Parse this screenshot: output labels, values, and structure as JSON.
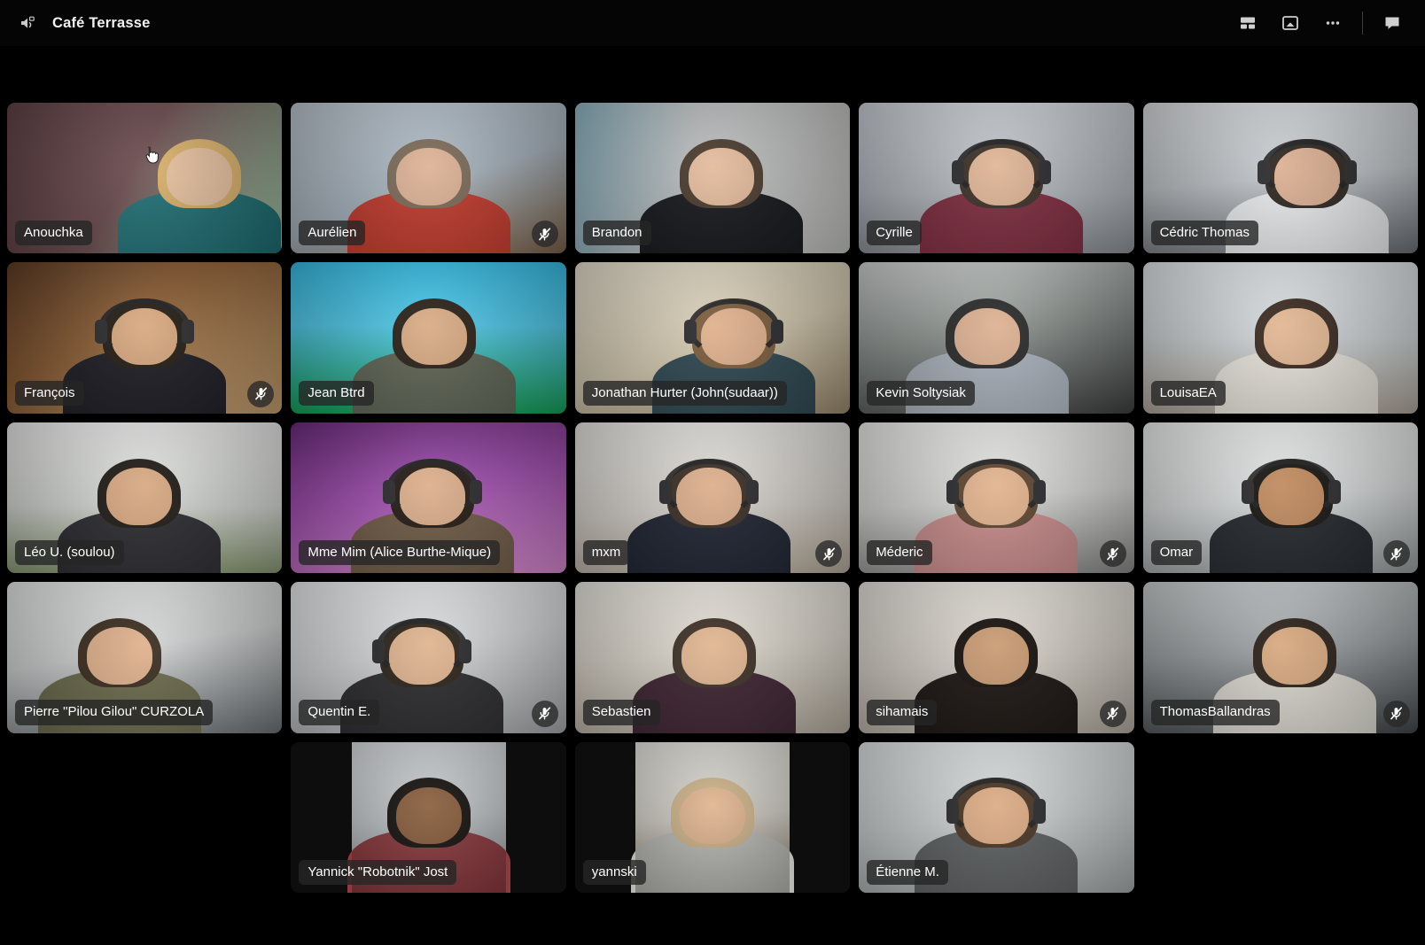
{
  "topbar": {
    "room_title": "Café Terrasse",
    "audio_icon": "speaker-lock-icon",
    "controls": [
      {
        "name": "layout-grid-button",
        "icon": "layout-grid-icon"
      },
      {
        "name": "present-screen-button",
        "icon": "screen-share-icon"
      },
      {
        "name": "more-options-button",
        "icon": "ellipsis-icon"
      },
      {
        "name": "chat-button",
        "icon": "chat-bubble-icon"
      }
    ]
  },
  "colors": {
    "active_speaker_border": "#3fc46a",
    "app_background": "#000000",
    "topbar_background": "#050505",
    "name_label_background": "rgba(38,38,38,0.80)"
  },
  "grid": {
    "columns": 5,
    "rows": 5,
    "participants": [
      {
        "name": "Anouchka",
        "muted": false,
        "active": false,
        "bg": "linear-gradient(120deg,#5e4044 0%,#6b4b4e 45%,#9fc6a6 100%)",
        "skin": "#e8c2a0",
        "hair": "#d9b06a",
        "shirt": "#1f6f74",
        "headset": false,
        "offsetx": 62,
        "cursor": true
      },
      {
        "name": "Aurélien",
        "muted": true,
        "active": false,
        "bg": "linear-gradient(160deg,#b9c3cc 0%,#a8b4be 55%,#7d6248 100%)",
        "skin": "#ddb295",
        "hair": "#7c6a58",
        "shirt": "#c0392b",
        "headset": false,
        "offsetx": 0,
        "cursor": false
      },
      {
        "name": "Brandon",
        "muted": false,
        "active": true,
        "bg": "linear-gradient(100deg,#8fb6c4 0%,#b9bcbd 40%,#c3c3c1 100%)",
        "skin": "#e4bb9c",
        "hair": "#4a3a2c",
        "shirt": "#14161a",
        "headset": false,
        "offsetx": 10,
        "cursor": false
      },
      {
        "name": "Cyrille",
        "muted": false,
        "active": false,
        "bg": "linear-gradient(180deg,#c9ced3 0%,#b4b9bf 60%,#8f9399 100%)",
        "skin": "#e0b596",
        "hair": "#3b3027",
        "shirt": "#7d2b3e",
        "headset": true,
        "offsetx": 6,
        "cursor": false
      },
      {
        "name": "Cédric Thomas",
        "muted": false,
        "active": false,
        "bg": "linear-gradient(175deg,#d7dadd 0%,#c2c6ca 50%,#6d7277 100%)",
        "skin": "#dcb093",
        "hair": "#2e2620",
        "shirt": "#e8eaec",
        "headset": true,
        "offsetx": 30,
        "cursor": false
      },
      {
        "name": "François",
        "muted": true,
        "active": false,
        "bg": "linear-gradient(150deg,#5b3a22 0%,#8a5c33 40%,#c8a272 100%)",
        "skin": "#d8a87f",
        "hair": "#241c14",
        "shirt": "#1b1b22",
        "headset": true,
        "offsetx": 0,
        "cursor": false
      },
      {
        "name": "Jean Btrd",
        "muted": false,
        "active": false,
        "bg": "linear-gradient(180deg,#35b9e0 0%,#51c8e8 42%,#17a05a 100%)",
        "skin": "#d9ab84",
        "hair": "#2a2018",
        "shirt": "#5d6354",
        "headset": false,
        "offsetx": 6,
        "cursor": false
      },
      {
        "name": "Jonathan Hurter (John(sudaar))",
        "muted": false,
        "active": false,
        "bg": "linear-gradient(160deg,#e3dccb 0%,#d4c9b0 55%,#9b8b6e 100%)",
        "skin": "#e0b18d",
        "hair": "#7b5c3c",
        "shirt": "#2d4650",
        "headset": true,
        "offsetx": 24,
        "cursor": false
      },
      {
        "name": "Kevin Soltysiak",
        "muted": false,
        "active": false,
        "bg": "linear-gradient(170deg,#cfd2d0 0%,#8e9491 45%,#3e4140 100%)",
        "skin": "#ddb192",
        "hair": "#2a2a2a",
        "shirt": "#a9b1bb",
        "headset": false,
        "offsetx": -10,
        "cursor": false
      },
      {
        "name": "LouisaEA",
        "muted": false,
        "active": false,
        "bg": "linear-gradient(180deg,#dfe3e6 0%,#cfd4d7 50%,#b0a79c 100%)",
        "skin": "#e2b793",
        "hair": "#3a2a20",
        "shirt": "#e6e2da",
        "headset": false,
        "offsetx": 18,
        "cursor": false
      },
      {
        "name": "Léo U. (soulou)",
        "muted": false,
        "active": false,
        "bg": "linear-gradient(180deg,#e6e7e6 0%,#d5d7d4 55%,#8a9b74 100%)",
        "skin": "#d8a881",
        "hair": "#1f1a15",
        "shirt": "#2b2b30",
        "headset": false,
        "offsetx": -6,
        "cursor": false
      },
      {
        "name": "Mme Mim (Alice Burthe-Mique)",
        "muted": false,
        "active": false,
        "bg": "linear-gradient(170deg,#6a2a7a 0%,#a14fb0 45%,#d88ad0 100%)",
        "skin": "#dcae8b",
        "hair": "#241a14",
        "shirt": "#6f5a46",
        "headset": true,
        "offsetx": 4,
        "cursor": false
      },
      {
        "name": "mxm",
        "muted": true,
        "active": false,
        "bg": "linear-gradient(175deg,#e6e4e0 0%,#d6d2cc 55%,#b8ad9c 100%)",
        "skin": "#dcae8b",
        "hair": "#3a2e24",
        "shirt": "#1d2230",
        "headset": true,
        "offsetx": -4,
        "cursor": false
      },
      {
        "name": "Méderic",
        "muted": true,
        "active": false,
        "bg": "linear-gradient(175deg,#ececea 0%,#d9d9d6 50%,#8b8b8b 100%)",
        "skin": "#e2b38e",
        "hair": "#5e4630",
        "shirt": "#c78a8a",
        "headset": true,
        "offsetx": 0,
        "cursor": false
      },
      {
        "name": "Omar",
        "muted": true,
        "active": false,
        "bg": "linear-gradient(175deg,#eceeee 0%,#dadddd 50%,#9ba0a2 100%)",
        "skin": "#c08a5e",
        "hair": "#171410",
        "shirt": "#23272c",
        "headset": true,
        "offsetx": 12,
        "cursor": false
      },
      {
        "name": "Pierre \"Pilou Gilou\" CURZOLA",
        "muted": false,
        "active": false,
        "bg": "linear-gradient(170deg,#e4e6e6 0%,#d2d4d4 45%,#6d7377 100%)",
        "skin": "#dfb18c",
        "hair": "#3b2d20",
        "shirt": "#6b6a4c",
        "headset": false,
        "offsetx": -28,
        "cursor": false
      },
      {
        "name": "Quentin E.",
        "muted": true,
        "active": false,
        "bg": "linear-gradient(170deg,#e8e9ea 0%,#d6d8da 45%,#a6a9ac 100%)",
        "skin": "#dfb48f",
        "hair": "#2d2318",
        "shirt": "#2b2b2e",
        "headset": true,
        "offsetx": -8,
        "cursor": false
      },
      {
        "name": "Sebastien",
        "muted": false,
        "active": false,
        "bg": "linear-gradient(175deg,#e9e6df 0%,#ddd8ce 45%,#b6ada0 100%)",
        "skin": "#e0b590",
        "hair": "#3d3026",
        "shirt": "#3c2230",
        "headset": false,
        "offsetx": 2,
        "cursor": false
      },
      {
        "name": "sihamais",
        "muted": true,
        "active": false,
        "bg": "linear-gradient(175deg,#e7e3dd 0%,#d6d1c8 50%,#b5aea3 100%)",
        "skin": "#c99a72",
        "hair": "#16100c",
        "shirt": "#1a1410",
        "headset": false,
        "offsetx": 0,
        "cursor": false
      },
      {
        "name": "ThomasBallandras",
        "muted": true,
        "active": false,
        "bg": "linear-gradient(175deg,#c9cdcf 0%,#9ba0a2 45%,#43484b 100%)",
        "skin": "#d7a87f",
        "hair": "#2a2118",
        "shirt": "#d8d5cd",
        "headset": false,
        "offsetx": 16,
        "cursor": false
      },
      {
        "name": "Yannick \"Robotnik\" Jost",
        "muted": false,
        "active": false,
        "bg": "linear-gradient(175deg,#d4d7da 0%,#bfc3c6 50%,#8e9295 100%)",
        "skin": "#8a5f3e",
        "hair": "#171310",
        "shirt": "#8c3a3f",
        "headset": false,
        "offsetx": 0,
        "cursor": false,
        "narrow": true
      },
      {
        "name": "yannski",
        "muted": false,
        "active": false,
        "bg": "linear-gradient(175deg,#e2e0da 0%,#cfccc4 50%,#8b7f6e 100%)",
        "skin": "#e0b590",
        "hair": "#cdb38a",
        "shirt": "#b9b9b4",
        "headset": false,
        "offsetx": 0,
        "cursor": false,
        "narrow": true
      },
      {
        "name": "Étienne M.",
        "muted": false,
        "active": true,
        "bg": "linear-gradient(175deg,#dfe3e4 0%,#cdd1d2 50%,#a9adaf 100%)",
        "skin": "#dcab84",
        "hair": "#4a3524",
        "shirt": "#5b5e60",
        "headset": true,
        "offsetx": 0,
        "cursor": false
      }
    ]
  }
}
